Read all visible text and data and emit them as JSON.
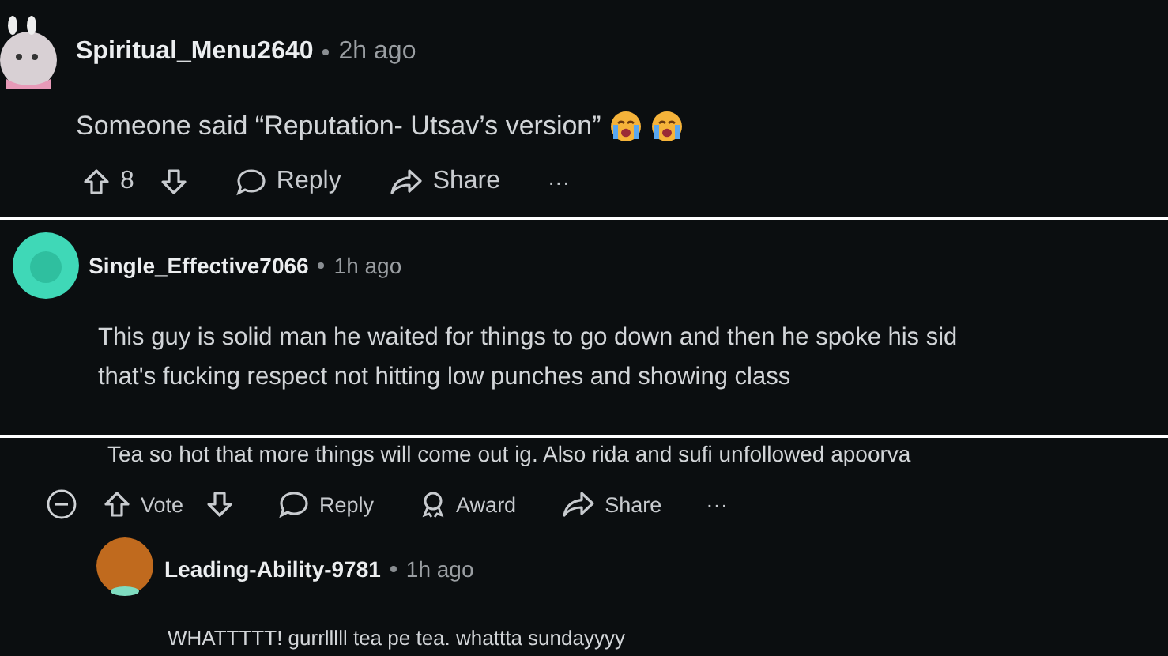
{
  "panels": [
    {
      "kind": "top",
      "author": "Spiritual_Menu2640",
      "time": "2h ago",
      "body": "Someone said “Reputation- Utsav’s version”",
      "actions": [
        {
          "kind": "vote",
          "label": "8"
        },
        {
          "kind": "reply",
          "label": "Reply"
        },
        {
          "kind": "share",
          "label": "Share"
        },
        {
          "kind": "more",
          "label": "···"
        }
      ]
    },
    {
      "kind": "middle",
      "author": "Single_Effective7066",
      "time": "1h ago",
      "body": "This guy is solid man he waited for things to go down and then he spoke his sid\nthat's fucking respect not hitting low punches and showing class"
    },
    {
      "kind": "thread",
      "body": "Tea so hot that more things will come out ig. Also rida and sufi unfollowed apoorva",
      "actions": [
        {
          "kind": "vote",
          "label": "Vote"
        },
        {
          "kind": "reply",
          "label": "Reply"
        },
        {
          "kind": "award",
          "label": "Award"
        },
        {
          "kind": "share",
          "label": "Share"
        },
        {
          "kind": "more",
          "label": "···"
        }
      ],
      "reply": {
        "author": "Leading-Ability-9781",
        "time": "1h ago",
        "body": "WHATTTTT! gurrlllll tea pe tea. whattta sundayyyy"
      }
    }
  ]
}
